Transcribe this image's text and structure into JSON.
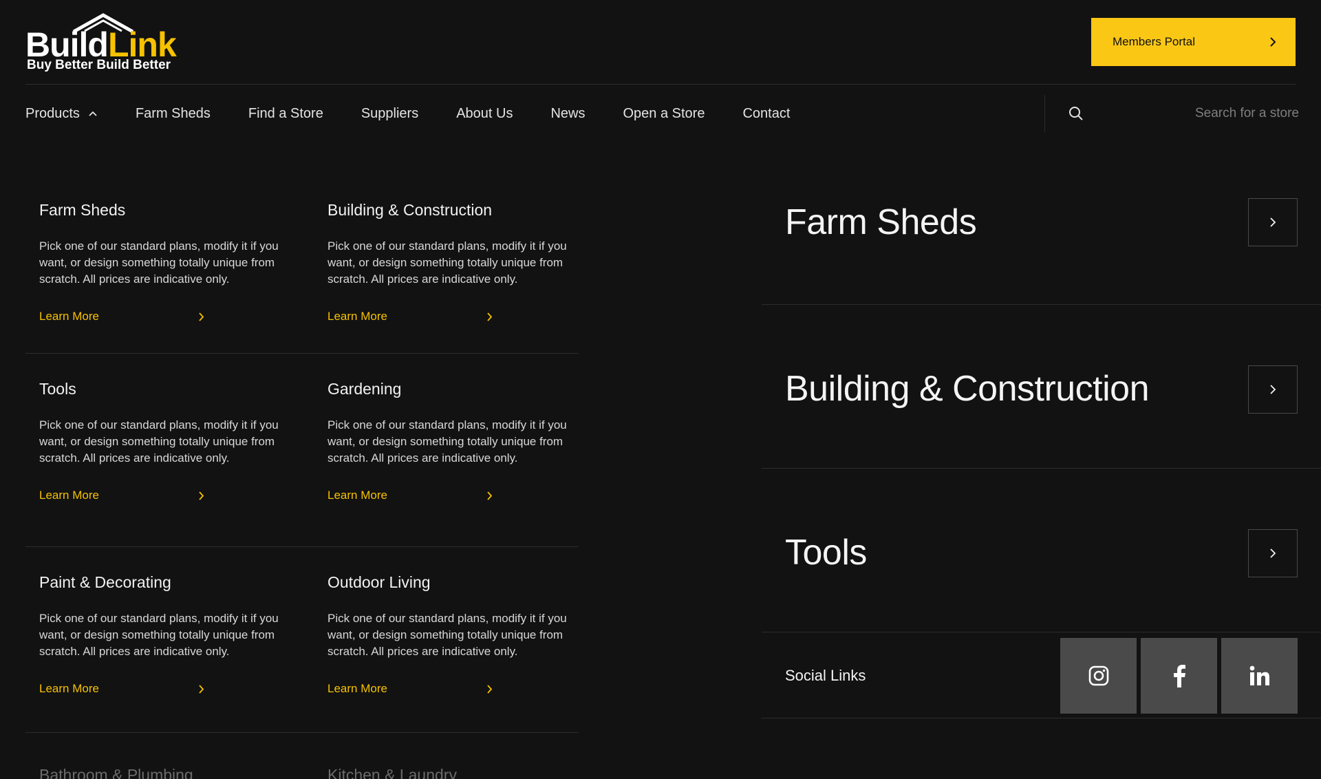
{
  "header": {
    "logo": {
      "word1": "Build",
      "word2": "Link",
      "tagline": "Buy Better Build Better"
    },
    "members_portal": {
      "label": "Members Portal",
      "icon": "chevron-right-icon"
    },
    "brand_color": "#fbc715"
  },
  "nav": {
    "items": [
      {
        "label": "Products",
        "expanded": true
      },
      {
        "label": "Farm Sheds"
      },
      {
        "label": "Find a Store"
      },
      {
        "label": "Suppliers"
      },
      {
        "label": "About Us"
      },
      {
        "label": "News"
      },
      {
        "label": "Open a Store"
      },
      {
        "label": "Contact"
      }
    ],
    "search": {
      "placeholder": "Search for a store",
      "icon": "search-icon"
    }
  },
  "products": {
    "rows": [
      [
        {
          "title": "Farm Sheds",
          "desc": "Pick one of our standard plans, modify it if you want, or design something totally unique from scratch. All prices are indicative only.",
          "link": "Learn More"
        },
        {
          "title": "Building & Construction",
          "desc": "Pick one of our standard plans, modify it if you want, or design something totally unique from scratch. All prices are indicative only.",
          "link": "Learn More"
        }
      ],
      [
        {
          "title": "Tools",
          "desc": "Pick one of our standard plans, modify it if you want, or design something totally unique from scratch. All prices are indicative only.",
          "link": "Learn More"
        },
        {
          "title": "Gardening",
          "desc": "Pick one of our standard plans, modify it if you want, or design something totally unique from scratch. All prices are indicative only.",
          "link": "Learn More"
        }
      ],
      [
        {
          "title": "Paint & Decorating",
          "desc": "Pick one of our standard plans, modify it if you want, or design something totally unique from scratch. All prices are indicative only.",
          "link": "Learn More"
        },
        {
          "title": "Outdoor Living",
          "desc": "Pick one of our standard plans, modify it if you want, or design something totally unique from scratch. All prices are indicative only.",
          "link": "Learn More"
        }
      ],
      [
        {
          "title": "Bathroom & Plumbing"
        },
        {
          "title": "Kitchen & Laundry"
        }
      ]
    ]
  },
  "featured": {
    "items": [
      {
        "title": "Farm Sheds"
      },
      {
        "title": "Building & Construction"
      },
      {
        "title": "Tools"
      }
    ],
    "social": {
      "label": "Social Links",
      "icons": [
        "instagram-icon",
        "facebook-icon",
        "linkedin-icon"
      ]
    }
  }
}
